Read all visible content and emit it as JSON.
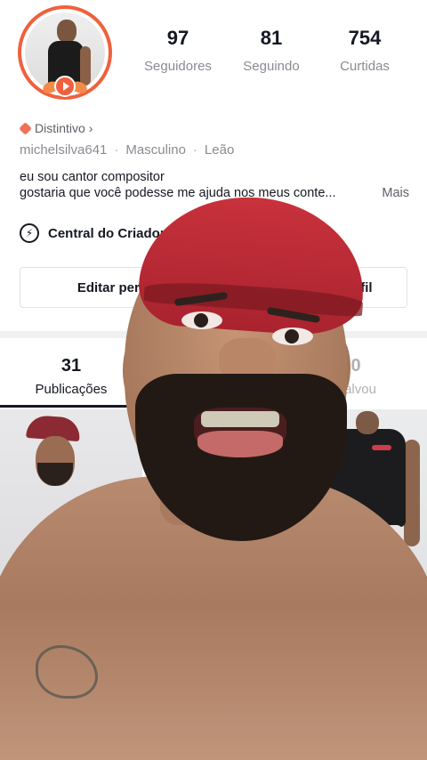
{
  "profile": {
    "stats": [
      {
        "value": "97",
        "label": "Seguidores"
      },
      {
        "value": "81",
        "label": "Seguindo"
      },
      {
        "value": "754",
        "label": "Curtidas"
      }
    ],
    "badge_label": "Distintivo",
    "badge_chevron": "›",
    "username": "michelsilva641",
    "gender": "Masculino",
    "zodiac": "Leão",
    "separator": "·",
    "bio_line1": "eu sou cantor compositor",
    "bio_line2": "gostaria que você podesse me ajuda nos meus conte...",
    "bio_more": "Mais",
    "creator_center": "Central do Criador",
    "edit_button": "Editar perfil",
    "share_button": "Compartilhar perfil"
  },
  "tabs": [
    {
      "count": "31",
      "label": "Publicações"
    },
    {
      "count": "",
      "label": ""
    },
    {
      "count": "0",
      "label": "Salvou"
    }
  ],
  "colors": {
    "accent": "#f0603c",
    "text_primary": "#161823",
    "text_secondary": "#8a8b91"
  },
  "icons": {
    "creator": "lightning-bolt-icon",
    "badge": "diamond-badge-icon",
    "live": "live-play-icon"
  }
}
